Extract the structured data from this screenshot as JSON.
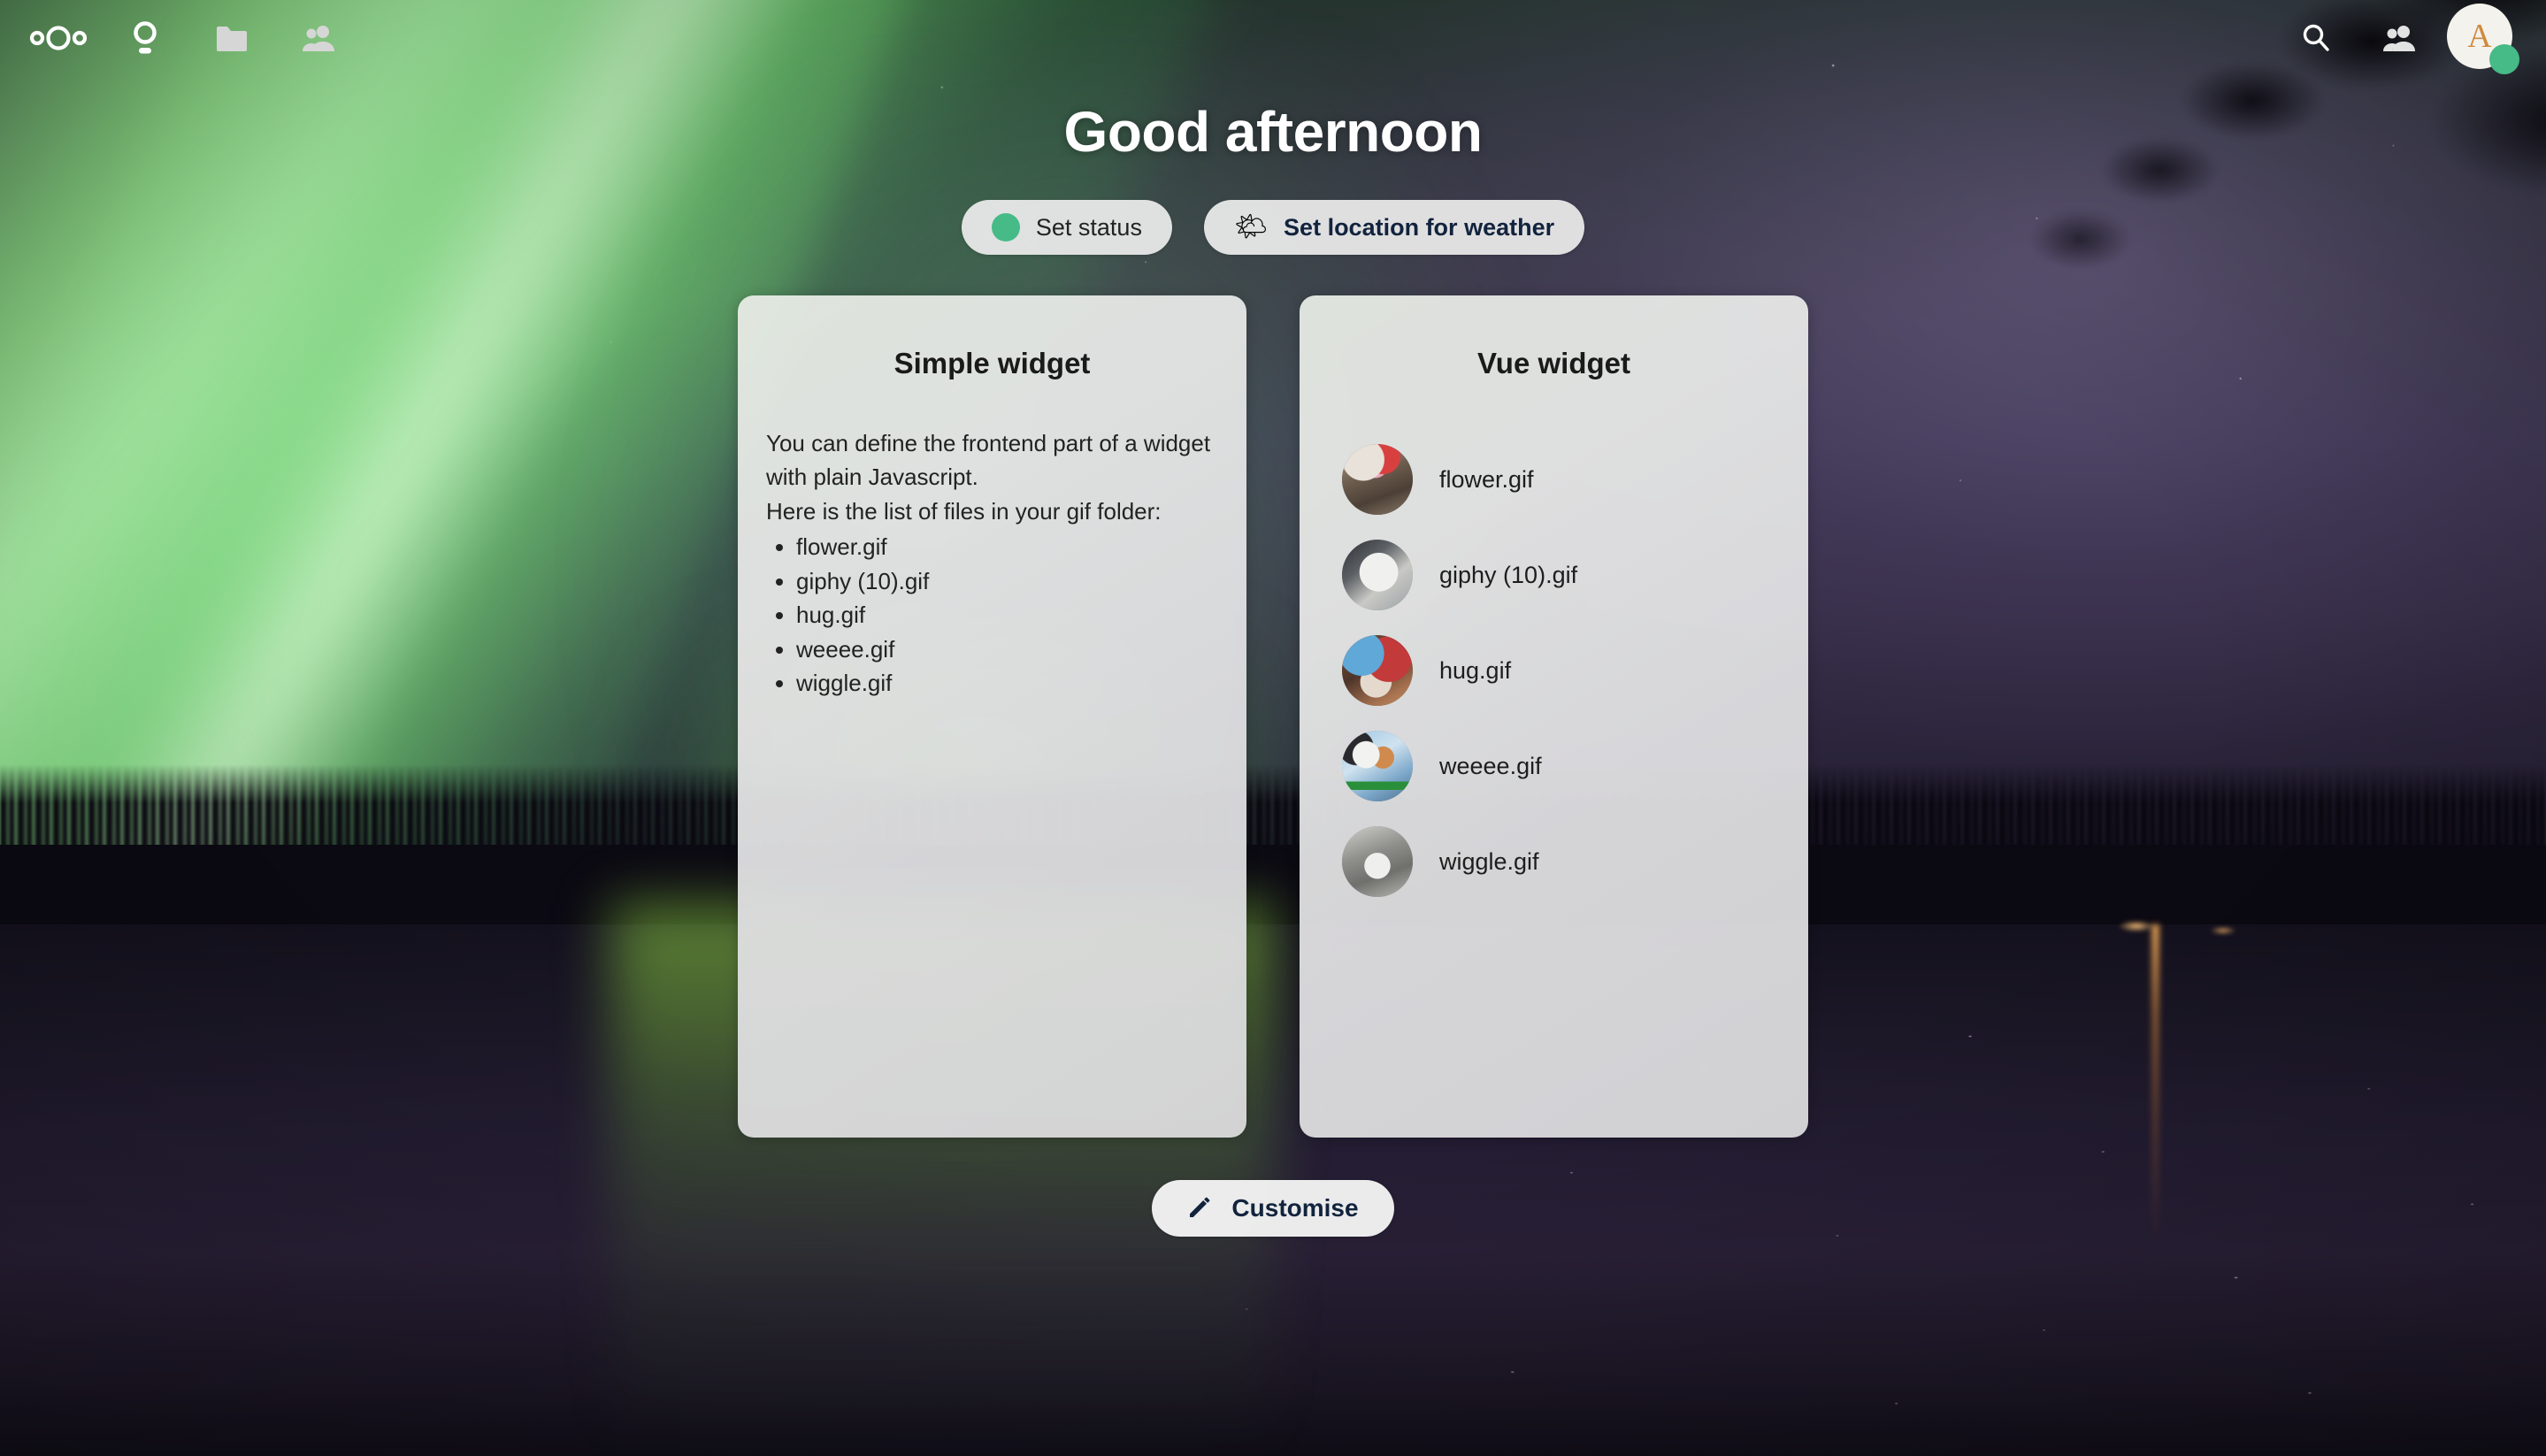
{
  "topbar": {
    "logo_name": "nextcloud-logo",
    "nav_items": [
      {
        "name": "dashboard-icon",
        "label": "Dashboard",
        "active": true
      },
      {
        "name": "folder-icon",
        "label": "Files",
        "active": false
      },
      {
        "name": "contacts-icon",
        "label": "Contacts",
        "active": false
      }
    ],
    "right_items": [
      {
        "name": "search-icon",
        "label": "Search"
      },
      {
        "name": "contacts-menu-icon",
        "label": "Contacts"
      }
    ],
    "avatar": {
      "initial": "A",
      "initial_color": "#d08a3e",
      "background": "#f4f2ec",
      "status_color": "#46ba87",
      "status": "online"
    }
  },
  "greeting": "Good afternoon",
  "status_buttons": [
    {
      "id": "set-status",
      "label": "Set status",
      "icon": "status-dot-icon",
      "dot_color": "#46ba87",
      "bold": false
    },
    {
      "id": "set-location-for-weather",
      "label": "Set location for weather",
      "icon": "sun-behind-cloud-icon",
      "emoji": "🌤",
      "bold": true
    }
  ],
  "widgets": [
    {
      "id": "simple-widget",
      "title": "Simple widget",
      "paragraphs": [
        "You can define the frontend part of a widget with plain Javascript.",
        "Here is the list of files in your gif folder:"
      ],
      "items": [
        "flower.gif",
        "giphy (10).gif",
        "hug.gif",
        "weeee.gif",
        "wiggle.gif"
      ]
    },
    {
      "id": "vue-widget",
      "title": "Vue widget",
      "items": [
        {
          "label": "flower.gif",
          "thumb": "t-flower",
          "thumb_name": "thumbnail-flower"
        },
        {
          "label": "giphy (10).gif",
          "thumb": "t-giphy",
          "thumb_name": "thumbnail-giphy"
        },
        {
          "label": "hug.gif",
          "thumb": "t-hug",
          "thumb_name": "thumbnail-hug"
        },
        {
          "label": "weeee.gif",
          "thumb": "t-weeee",
          "thumb_name": "thumbnail-weeee"
        },
        {
          "label": "wiggle.gif",
          "thumb": "t-wiggle",
          "thumb_name": "thumbnail-wiggle"
        }
      ]
    }
  ],
  "customise": {
    "label": "Customise",
    "icon": "pencil-icon",
    "text_color": "#12233d"
  },
  "colors": {
    "accent_green": "#46ba87",
    "card_background": "#e4e4e6",
    "title_text": "#1a1a1a",
    "body_text": "#222222",
    "dark_navy": "#12233d"
  }
}
